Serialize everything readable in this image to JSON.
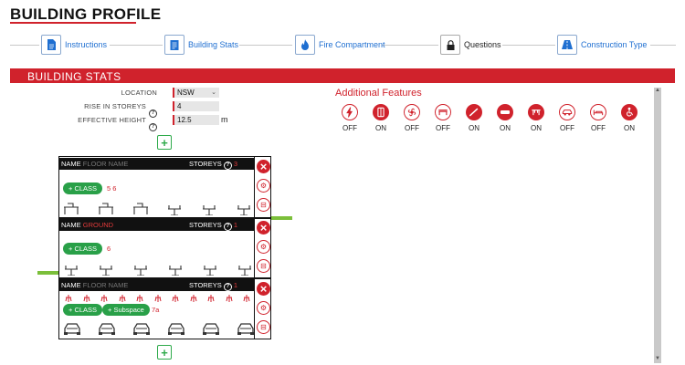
{
  "header": {
    "title": "BUILDING PROFILE"
  },
  "steps": [
    {
      "label": "Instructions",
      "icon": "document-icon"
    },
    {
      "label": "Building Stats",
      "icon": "clipboard-icon"
    },
    {
      "label": "Fire Compartment",
      "icon": "fire-icon"
    },
    {
      "label": "Questions",
      "icon": "lock-icon"
    },
    {
      "label": "Construction Type",
      "icon": "road-icon"
    }
  ],
  "section": {
    "title": "BUILDING STATS"
  },
  "stats": {
    "location_label": "LOCATION",
    "location_value": "NSW",
    "rise_label": "RISE IN STOREYS",
    "rise_value": "4",
    "height_label": "EFFECTIVE HEIGHT",
    "height_value": "12.5",
    "height_unit": "m",
    "help": "?"
  },
  "additional_features": {
    "title": "Additional Features",
    "items": [
      {
        "icon": "lightning-icon",
        "status": "OFF"
      },
      {
        "icon": "sprinkler-icon",
        "status": "ON"
      },
      {
        "icon": "fan-icon",
        "status": "OFF"
      },
      {
        "icon": "bench-icon",
        "status": "OFF"
      },
      {
        "icon": "ramp-icon",
        "status": "ON"
      },
      {
        "icon": "smoke-detector-icon",
        "status": "ON"
      },
      {
        "icon": "table-icon",
        "status": "ON"
      },
      {
        "icon": "vehicle-icon",
        "status": "OFF"
      },
      {
        "icon": "bed-icon",
        "status": "OFF"
      },
      {
        "icon": "wheelchair-icon",
        "status": "ON"
      }
    ]
  },
  "floors": [
    {
      "name_label": "NAME",
      "name_value": "FLOOR NAME",
      "storeys_label": "STOREYS",
      "storeys_value": "3",
      "class_label": "CLASS",
      "class_nums": "5  6"
    },
    {
      "name_label": "NAME",
      "name_value": "GROUND",
      "storeys_label": "STOREYS",
      "storeys_value": "1",
      "class_label": "CLASS",
      "class_nums": "6"
    },
    {
      "name_label": "NAME",
      "name_value": "FLOOR NAME",
      "storeys_label": "STOREYS",
      "storeys_value": "1",
      "class_label": "CLASS",
      "subspace_label": "Subspace",
      "class_nums": "7a"
    }
  ]
}
